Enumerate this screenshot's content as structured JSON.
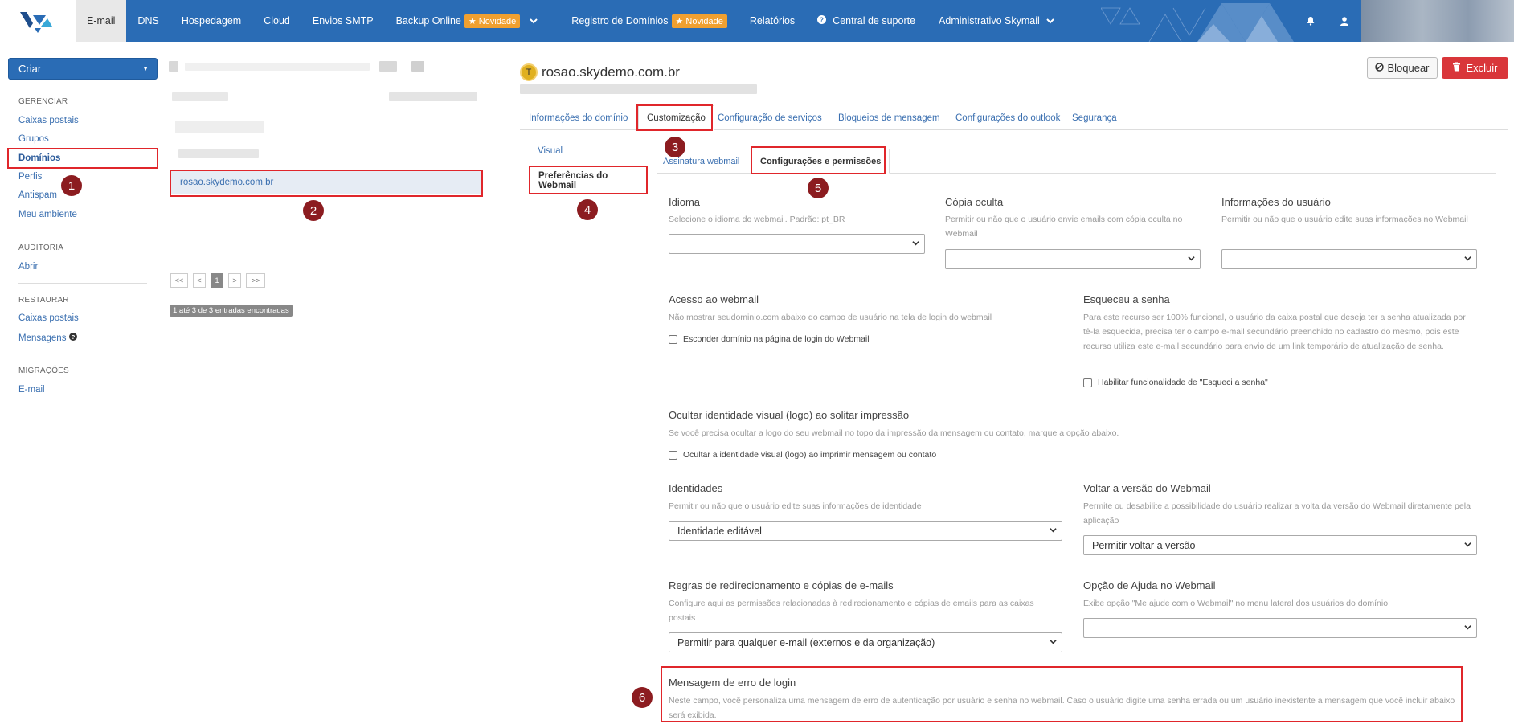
{
  "topnav": {
    "items": [
      {
        "label": "E-mail"
      },
      {
        "label": "DNS"
      },
      {
        "label": "Hospedagem"
      },
      {
        "label": "Cloud"
      },
      {
        "label": "Envios SMTP"
      },
      {
        "label": "Backup Online"
      },
      {
        "label": "Registro de Domínios"
      },
      {
        "label": "Relatórios"
      },
      {
        "label": "Central de suporte"
      },
      {
        "label": "Administrativo Skymail"
      }
    ],
    "badge_new": "★ Novidade",
    "badge_new2": "★ Novidade"
  },
  "sidebar": {
    "create_label": "Criar",
    "sections": {
      "gerenciar": "GERENCIAR",
      "auditoria": "AUDITORIA",
      "restaurar": "RESTAURAR",
      "migracoes": "MIGRAÇÕES"
    },
    "links": {
      "caixas_postais": "Caixas postais",
      "grupos": "Grupos",
      "dominios": "Domínios",
      "perfis": "Perfis",
      "antispam": "Antispam",
      "meu_ambiente": "Meu ambiente",
      "abrir": "Abrir",
      "restaurar_caixas": "Caixas postais",
      "mensagens": "Mensagens",
      "email": "E-mail"
    }
  },
  "middle": {
    "selected_domain": "rosao.skydemo.com.br",
    "pager": [
      "<<",
      "<",
      "1",
      ">",
      ">>"
    ],
    "count_text": "1 até 3 de 3 entradas encontradas"
  },
  "markers": [
    "1",
    "2",
    "3",
    "4",
    "5",
    "6"
  ],
  "main": {
    "domain_icon_letter": "T",
    "domain_title": "rosao.skydemo.com.br",
    "btn_bloquear": "Bloquear",
    "btn_excluir": "Excluir",
    "tabs": [
      {
        "label": "Informações do domínio"
      },
      {
        "label": "Customização"
      },
      {
        "label": "Configuração de serviços"
      },
      {
        "label": "Bloqueios de mensagem"
      },
      {
        "label": "Configurações do outlook"
      },
      {
        "label": "Segurança"
      }
    ],
    "vnav": {
      "visual": "Visual",
      "prefs": "Preferências do Webmail"
    },
    "subtabs": {
      "assinatura": "Assinatura webmail",
      "config": "Configurações e permissões"
    },
    "fields": {
      "idioma": {
        "title": "Idioma",
        "desc": "Selecione o idioma do webmail. Padrão: pt_BR",
        "value": ""
      },
      "copia": {
        "title": "Cópia oculta",
        "desc": "Permitir ou não que o usuário envie emails com cópia oculta no Webmail",
        "value": ""
      },
      "info_usuario": {
        "title": "Informações do usuário",
        "desc": "Permitir ou não que o usuário edite suas informações no Webmail",
        "value": ""
      },
      "acesso": {
        "title": "Acesso ao webmail",
        "desc": "Não mostrar seudominio.com abaixo do campo de usuário na tela de login do webmail",
        "check": "Esconder domínio na página de login do Webmail"
      },
      "esqueceu": {
        "title": "Esqueceu a senha",
        "desc": "Para este recurso ser 100% funcional, o usuário da caixa postal que deseja ter a senha atualizada por tê-la esquecida, precisa ter o campo e-mail secundário preenchido no cadastro do mesmo, pois este recurso utiliza este e-mail secundário para envio de um link temporário de atualização de senha.",
        "check": "Habilitar funcionalidade de \"Esqueci a senha\""
      },
      "ocultar": {
        "title": "Ocultar identidade visual (logo) ao solitar impressão",
        "desc": "Se você precisa ocultar a logo do seu webmail no topo da impressão da mensagem ou contato, marque a opção abaixo.",
        "check": "Ocultar a identidade visual (logo) ao imprimir mensagem ou contato"
      },
      "identidades": {
        "title": "Identidades",
        "desc": "Permitir ou não que o usuário edite suas informações de identidade",
        "value": "Identidade editável"
      },
      "voltar": {
        "title": "Voltar a versão do Webmail",
        "desc": "Permite ou desabilite a possibilidade do usuário realizar a volta da versão do Webmail diretamente pela aplicação",
        "value": "Permitir voltar a versão"
      },
      "regras": {
        "title": "Regras de redirecionamento e cópias de e-mails",
        "desc": "Configure aqui as permissões relacionadas à redirecionamento e cópias de emails para as caixas postais",
        "value": "Permitir para qualquer e-mail (externos e da organização)"
      },
      "ajuda": {
        "title": "Opção de Ajuda no Webmail",
        "desc": "Exibe opção \"Me ajude com o Webmail\" no menu lateral dos usuários do domínio",
        "value": ""
      },
      "erro_login": {
        "title": "Mensagem de erro de login",
        "desc": "Neste campo, você personaliza uma mensagem de erro de autenticação por usuário e senha no webmail. Caso o usuário digite uma senha errada ou um usuário inexistente a mensagem que você incluir abaixo será exibida."
      }
    }
  },
  "colors": {
    "brand": "#2a6cb5",
    "highlight": "#e0262b",
    "marker": "#8c1c20",
    "badge": "#f0a030",
    "danger": "#d9363a"
  }
}
